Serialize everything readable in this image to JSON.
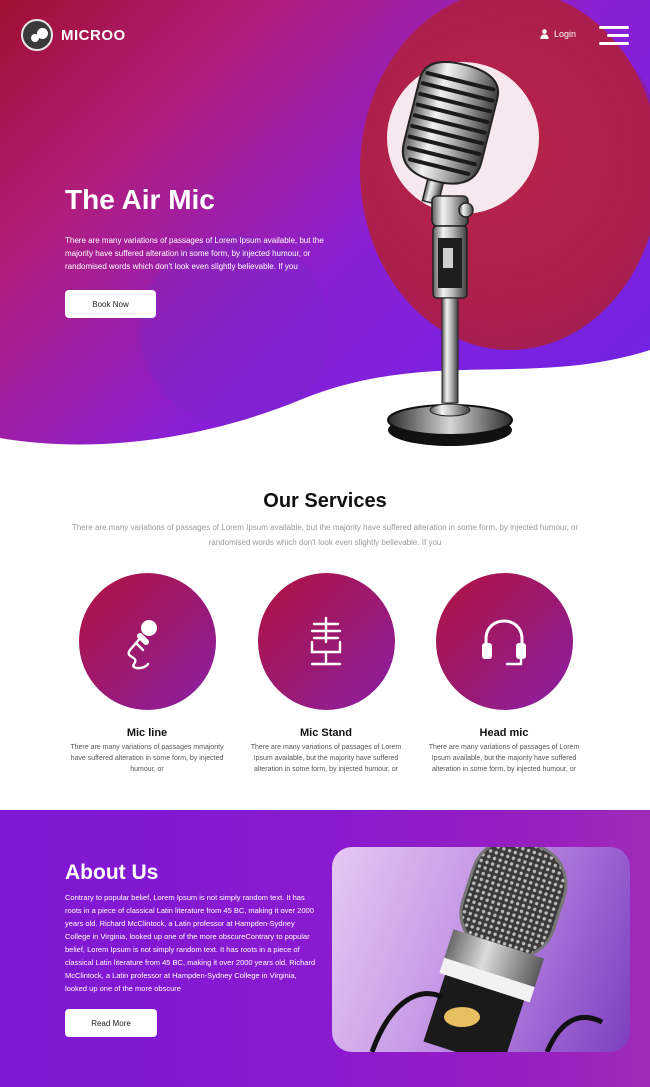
{
  "header": {
    "brand": "MICROO",
    "login_label": "Login",
    "icons": [
      "microphone-logo-icon",
      "user-icon",
      "hamburger-menu-icon"
    ]
  },
  "hero": {
    "title": "The Air Mic",
    "text": "There are many variations of passages of Lorem Ipsum available, but the majority have suffered alteration in some form, by injected humour, or randomised words which don't look even slightly believable.  If you",
    "button_label": "Book Now"
  },
  "services": {
    "title": "Our Services",
    "subtitle": "There are many variations of passages of Lorem Ipsum available, but the majority have suffered alteration in some form, by injected humour, or randomised words which don't look even slightly believable.  If you",
    "items": [
      {
        "name": "Mic line",
        "icon": "handheld-mic-icon",
        "desc": "There are many variations of passages mmajority have suffered alteration in some form, by injected humour, or"
      },
      {
        "name": "Mic Stand",
        "icon": "mic-stand-icon",
        "desc": "There are many variations of passages of Lorem Ipsum available, but the majority have suffered alteration in some form, by injected humour, or"
      },
      {
        "name": "Head mic",
        "icon": "headset-icon",
        "desc": "There are many variations of passages of Lorem Ipsum available, but the majority have suffered alteration in some form, by injected humour, or"
      }
    ]
  },
  "about": {
    "title": "About Us",
    "text": "Contrary to popular belief, Lorem Ipsum is not simply random text. It has roots in a piece of classical Latin literature from 45 BC, making it over 2000 years old. Richard McClintock, a Latin professor at Hampden-Sydney College in Virginia, looked up one of the more obscureContrary to popular belief, Lorem Ipsum is not simply random text. It has roots in a piece of classical Latin literature from 45 BC, making it over 2000 years old. Richard McClintock, a Latin professor at Hampden-Sydney College in Virginia, looked up one of the more obscure",
    "button_label": "Read More"
  },
  "colors": {
    "accent_purple": "#7b21df",
    "accent_crimson": "#ac1f4d",
    "service_circle": "#9a1a74"
  }
}
